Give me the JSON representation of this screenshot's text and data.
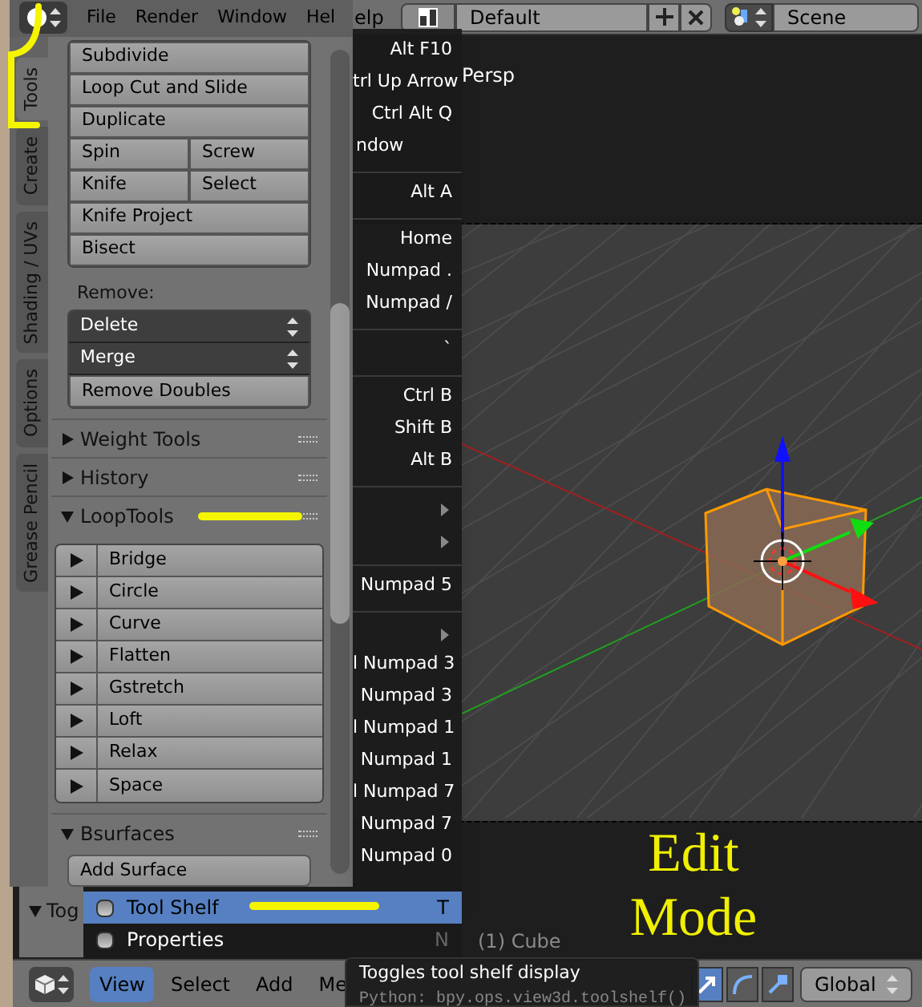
{
  "top_header": {
    "menu_fragment": "elp",
    "layout": "Default",
    "scene": "Scene"
  },
  "viewport": {
    "view_label": "Persp",
    "object_label": "(1) Cube",
    "caption": [
      "Edit",
      "Mode"
    ]
  },
  "tool_shelf": {
    "menus": [
      "File",
      "Render",
      "Window",
      "Hel"
    ],
    "tabs": [
      {
        "label": "Tools",
        "selected": true
      },
      {
        "label": "Create",
        "selected": false
      },
      {
        "label": "Shading / UVs",
        "selected": false
      },
      {
        "label": "Options",
        "selected": false
      },
      {
        "label": "Grease Pencil",
        "selected": false
      }
    ],
    "tool_rows": [
      [
        "Subdivide"
      ],
      [
        "Loop Cut and Slide"
      ],
      [
        "Duplicate"
      ],
      [
        "Spin",
        "Screw"
      ],
      [
        "Knife",
        "Select"
      ],
      [
        "Knife Project"
      ],
      [
        "Bisect"
      ]
    ],
    "remove_label": "Remove:",
    "remove_rows": [
      {
        "label": "Delete",
        "kind": "dropdown"
      },
      {
        "label": "Merge",
        "kind": "dropdown"
      },
      {
        "label": "Remove Doubles",
        "kind": "button"
      }
    ],
    "panels": [
      {
        "title": "Weight Tools",
        "expanded": false
      },
      {
        "title": "History",
        "expanded": false
      },
      {
        "title": "LoopTools",
        "expanded": true,
        "kind": "expandable_list",
        "items": [
          "Bridge",
          "Circle",
          "Curve",
          "Flatten",
          "Gstretch",
          "Loft",
          "Relax",
          "Space"
        ]
      },
      {
        "title": "Bsurfaces",
        "expanded": true,
        "kind": "plain",
        "items": [
          "Add Surface"
        ]
      }
    ],
    "next_panel": {
      "title": "Tog",
      "expanded": true
    }
  },
  "shortcut_menu": [
    {
      "kind": "shortcut",
      "text": "Alt F10"
    },
    {
      "kind": "shortcut",
      "text": "trl Up Arrow"
    },
    {
      "kind": "shortcut",
      "text": "Ctrl Alt Q"
    },
    {
      "kind": "label",
      "text": "ndow"
    },
    {
      "kind": "separator"
    },
    {
      "kind": "shortcut",
      "text": "Alt A"
    },
    {
      "kind": "separator"
    },
    {
      "kind": "shortcut",
      "text": "Home"
    },
    {
      "kind": "shortcut",
      "text": "Numpad ."
    },
    {
      "kind": "shortcut",
      "text": "Numpad /"
    },
    {
      "kind": "separator"
    },
    {
      "kind": "shortcut",
      "text": "`"
    },
    {
      "kind": "separator"
    },
    {
      "kind": "shortcut",
      "text": "Ctrl B"
    },
    {
      "kind": "shortcut",
      "text": "Shift B"
    },
    {
      "kind": "shortcut",
      "text": "Alt B"
    },
    {
      "kind": "separator"
    },
    {
      "kind": "submenu"
    },
    {
      "kind": "submenu"
    },
    {
      "kind": "separator"
    },
    {
      "kind": "shortcut",
      "text": "Numpad 5"
    },
    {
      "kind": "separator"
    },
    {
      "kind": "submenu"
    },
    {
      "kind": "shortcut",
      "text": "l Numpad 3"
    },
    {
      "kind": "shortcut",
      "text": "Numpad 3"
    },
    {
      "kind": "shortcut",
      "text": "l Numpad 1"
    },
    {
      "kind": "shortcut",
      "text": "Numpad 1"
    },
    {
      "kind": "shortcut",
      "text": "l Numpad 7"
    },
    {
      "kind": "shortcut",
      "text": "Numpad 7"
    },
    {
      "kind": "shortcut",
      "text": "Numpad 0"
    }
  ],
  "view_menu": [
    {
      "label": "Tool Shelf",
      "shortcut": "T",
      "selected": true,
      "checked": false
    },
    {
      "label": "Properties",
      "shortcut": "N",
      "selected": false,
      "checked": false
    }
  ],
  "tooltip": {
    "text": "Toggles tool shelf display",
    "python": "Python: bpy.ops.view3d.toolshelf()"
  },
  "bottom_header": {
    "menus": [
      {
        "label": "View",
        "selected": true
      },
      {
        "label": "Select",
        "selected": false
      },
      {
        "label": "Add",
        "selected": false
      },
      {
        "label": "Me",
        "selected": false
      }
    ],
    "orientation": "Global"
  }
}
